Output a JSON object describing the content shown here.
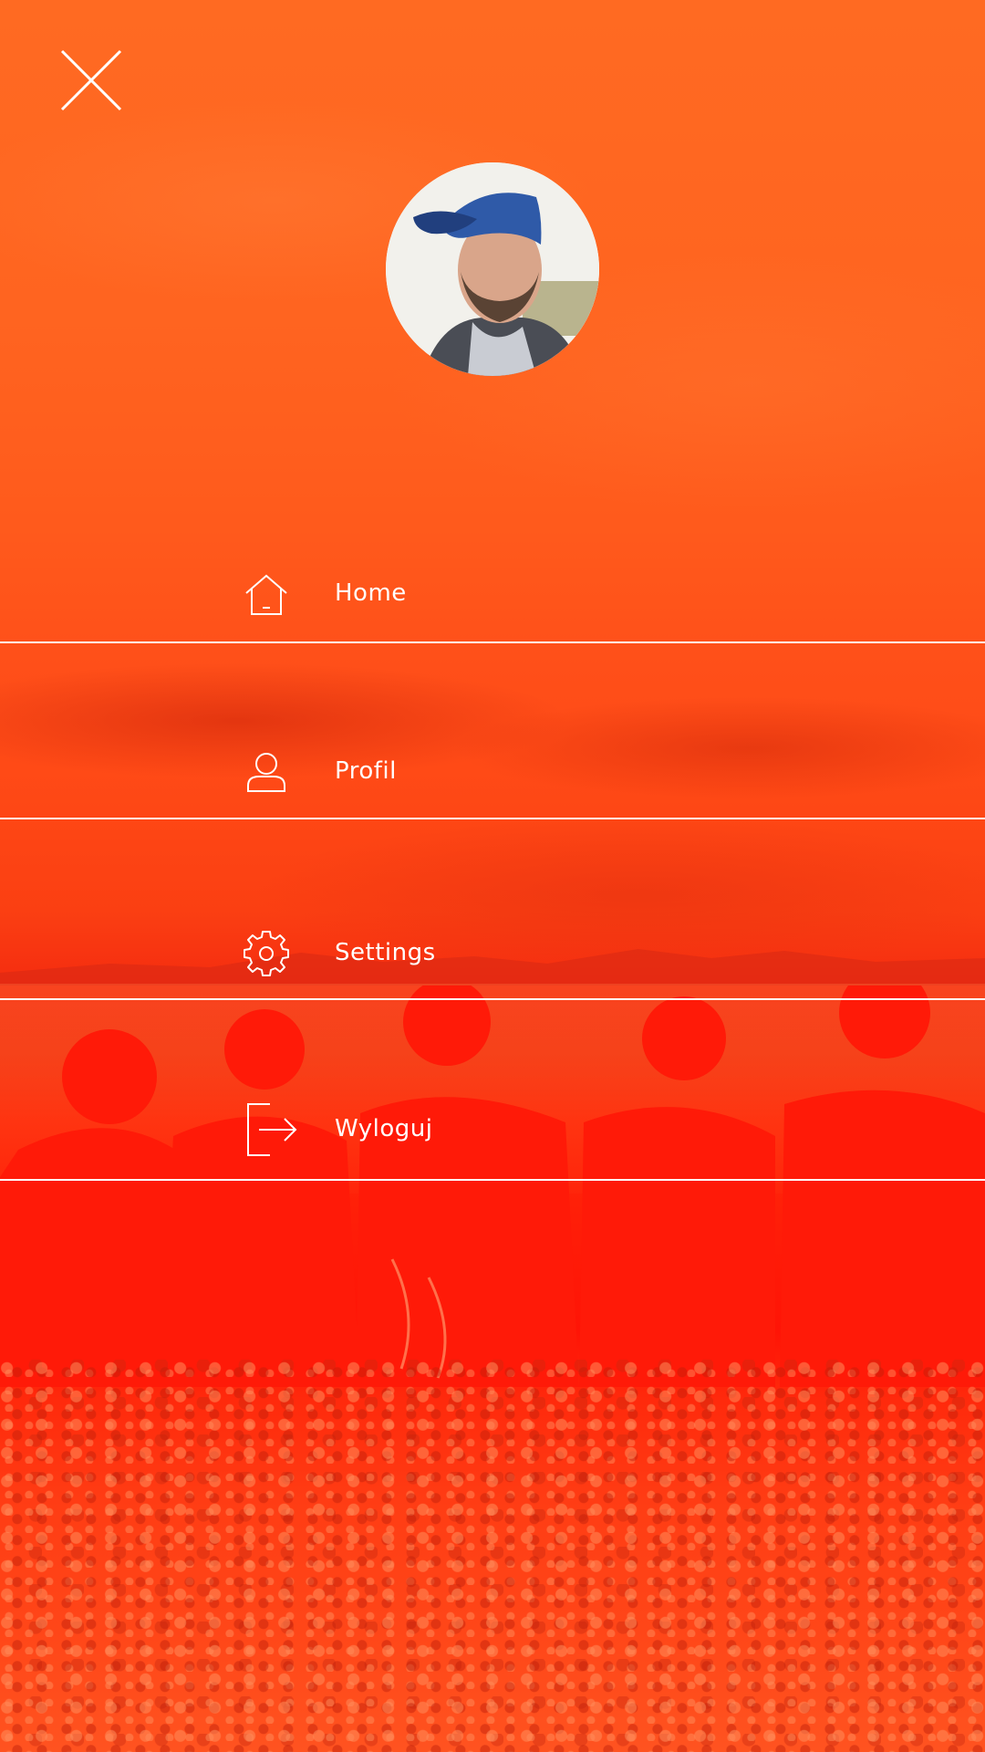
{
  "menu": {
    "close_icon": "close-icon",
    "avatar_icon": "avatar",
    "items": [
      {
        "label": "Home",
        "icon": "home-icon"
      },
      {
        "label": "Profil",
        "icon": "user-icon"
      },
      {
        "label": "Settings",
        "icon": "gear-icon"
      },
      {
        "label": "Wyloguj",
        "icon": "logout-icon"
      }
    ]
  },
  "colors": {
    "background_top": "#ff6a22",
    "background_bottom": "#ff1406",
    "foreground": "#ffffff"
  }
}
